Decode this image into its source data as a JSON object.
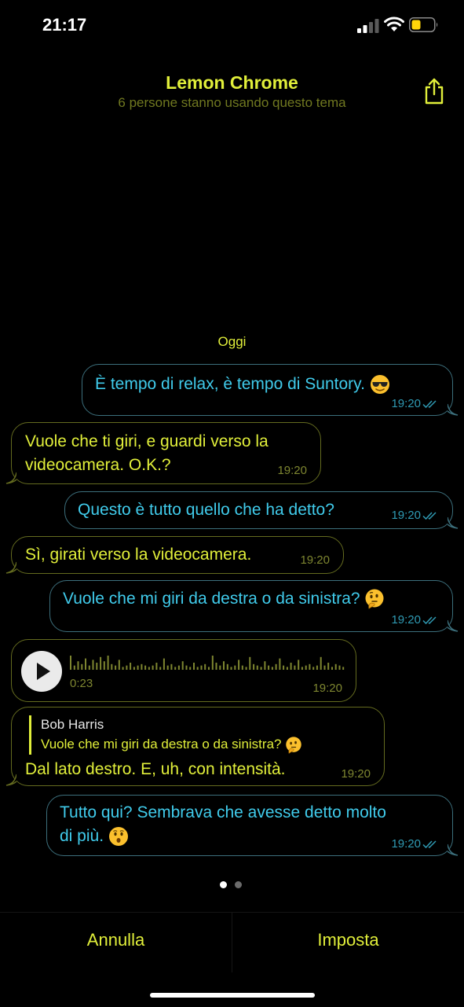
{
  "status_bar": {
    "time": "21:17",
    "battery_color": "#ffd60a"
  },
  "header": {
    "title": "Lemon Chrome",
    "subtitle": "6 persone stanno usando questo tema",
    "share_icon": "share-icon"
  },
  "date_label": "Oggi",
  "messages": [
    {
      "type": "outgoing",
      "text": "È tempo di relax, è tempo di Suntory.",
      "emoji": "smiling-face-with-sunglasses",
      "time": "19:20",
      "read": true
    },
    {
      "type": "incoming",
      "text_lines": [
        "Vuole che ti giri, e guardi verso la",
        "videocamera. O.K.?"
      ],
      "time": "19:20"
    },
    {
      "type": "outgoing",
      "text": "Questo è tutto quello che ha detto?",
      "time": "19:20",
      "read": true
    },
    {
      "type": "incoming",
      "text": "Sì, girati verso la videocamera.",
      "time": "19:20"
    },
    {
      "type": "outgoing",
      "text": "Vuole che mi giri da destra o da sinistra?",
      "emoji": "thinking-face",
      "time": "19:20",
      "read": true
    },
    {
      "type": "incoming-voice",
      "duration": "0:23",
      "time": "19:20"
    },
    {
      "type": "incoming-reply",
      "quote_author": "Bob Harris",
      "quote_text": "Vuole che mi giri da destra o da sinistra?",
      "quote_emoji": "thinking-face",
      "text": "Dal lato destro. E, uh, con intensità.",
      "time": "19:20"
    },
    {
      "type": "outgoing",
      "text_lines": [
        "Tutto qui? Sembrava che avesse detto molto",
        "di più."
      ],
      "emoji": "hushed-face",
      "time": "19:20",
      "read": true
    }
  ],
  "pager": {
    "pages": 2,
    "current": 1
  },
  "footer": {
    "cancel_label": "Annulla",
    "set_label": "Imposta"
  },
  "colors": {
    "accent_yellow": "#e1ef3a",
    "outgoing_text": "#40cbeb",
    "background": "#000000"
  }
}
